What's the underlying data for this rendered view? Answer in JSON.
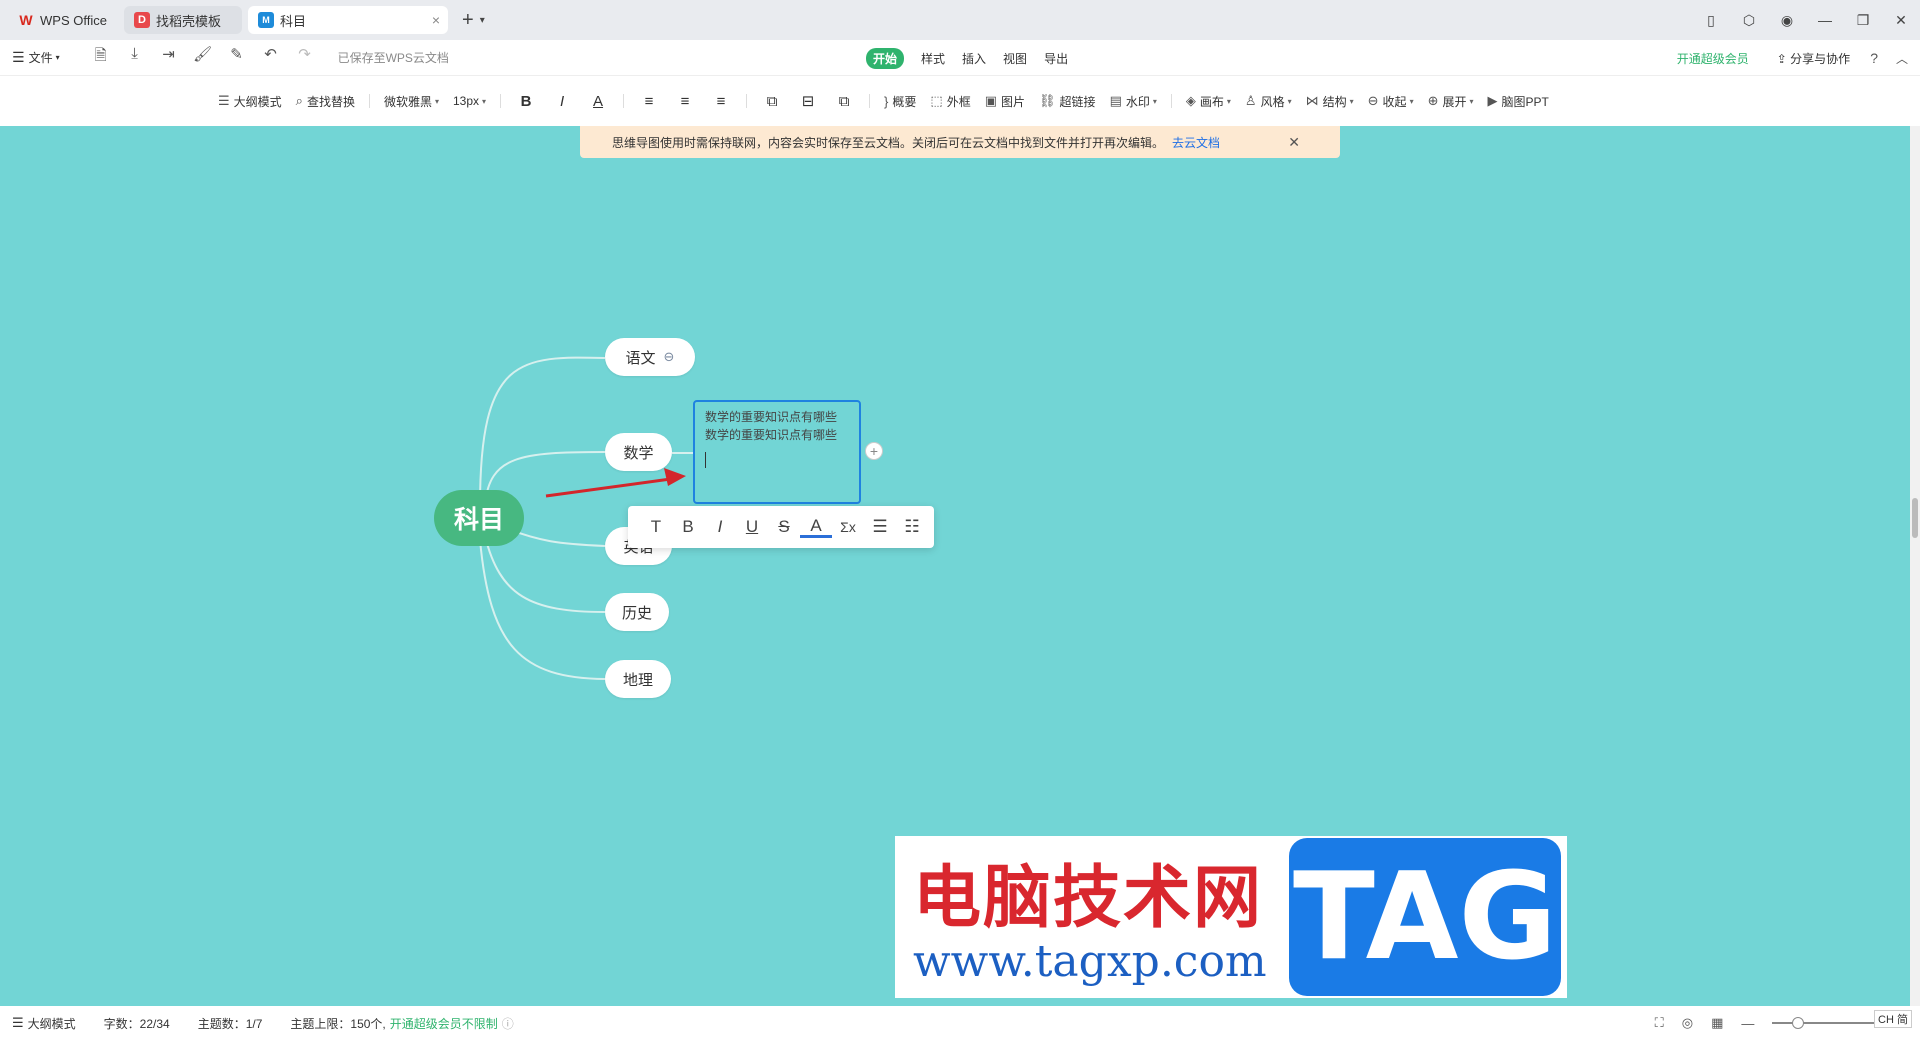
{
  "tabs": {
    "wps": "WPS Office",
    "template": "找稻壳模板",
    "active": "科目",
    "close": "×",
    "new": "+"
  },
  "menubar": {
    "file": "文件",
    "saved_status": "已保存至WPS云文档",
    "tabs": [
      "开始",
      "样式",
      "插入",
      "视图",
      "导出"
    ],
    "vip": "开通超级会员",
    "share": "分享与协作",
    "help": "?"
  },
  "toolbar": {
    "outline_mode": "大纲模式",
    "find_replace": "查找替换",
    "font": "微软雅黑",
    "font_size": "13px",
    "summary": "概要",
    "frame": "外框",
    "image": "图片",
    "hyperlink": "超链接",
    "watermark": "水印",
    "canvas": "画布",
    "style": "风格",
    "structure": "结构",
    "collapse": "收起",
    "expand": "展开",
    "mindmap_ppt": "脑图PPT"
  },
  "notice": {
    "text": "思维导图使用时需保持联网，内容会实时保存至云文档。关闭后可在云文档中找到文件并打开再次编辑。",
    "link": "去云文档"
  },
  "mindmap": {
    "root": "科目",
    "children": [
      "语文",
      "数学",
      "英语",
      "历史",
      "地理"
    ],
    "editing_text_line1": "数学的重要知识点有哪些",
    "editing_text_line2": "数学的重要知识点有哪些"
  },
  "format_bar": {
    "items": [
      "T",
      "B",
      "I",
      "U",
      "S",
      "A",
      "Σx",
      "list",
      "ordered-list"
    ]
  },
  "watermark": {
    "title": "电脑技术网",
    "url": "www.tagxp.com",
    "tag": "TAG"
  },
  "statusbar": {
    "outline_mode": "大纲模式",
    "word_count": "字数：22/34",
    "topic_count": "主题数：1/7",
    "topic_limit": "主题上限：150个,",
    "vip_unlimited": "开通超级会员不限制"
  },
  "ime": "CH 简",
  "colors": {
    "canvas_bg": "#72d5d5",
    "root_node": "#47b881",
    "accent_green": "#2fb36d",
    "edit_border": "#1f82e0",
    "arrow": "#d3262b"
  }
}
